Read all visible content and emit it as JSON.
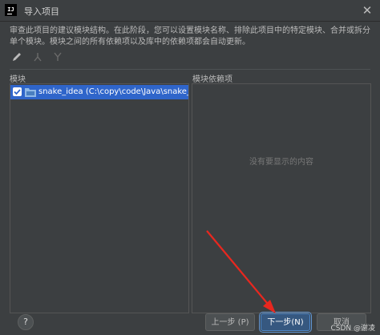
{
  "window": {
    "app_icon_text": "IJ",
    "title": "导入项目"
  },
  "description": "审查此项目的建议模块结构。在此阶段，您可以设置模块名称、排除此项目中的特定模块、合并或拆分单个模块。模块之间的所有依赖项以及库中的依赖项都会自动更新。",
  "toolbar": {
    "icons": [
      "edit-icon",
      "split-icon",
      "merge-icon"
    ]
  },
  "modules": {
    "header": "模块",
    "items": [
      {
        "label": "snake_idea (C:\\copy\\code\\Java\\snake_idea) [s",
        "checked": true
      }
    ]
  },
  "dependencies": {
    "header": "模块依赖项",
    "empty_text": "没有要显示的内容"
  },
  "footer": {
    "help_label": "?",
    "prev_label": "上一步 (P)",
    "next_label": "下一步(N)",
    "cancel_label": "取消"
  },
  "watermark": "CSDN @谢凌",
  "colors": {
    "background": "#3c3f41",
    "selection": "#2f65ca",
    "primary_button": "#365880",
    "annotation_arrow": "#e8271f"
  }
}
